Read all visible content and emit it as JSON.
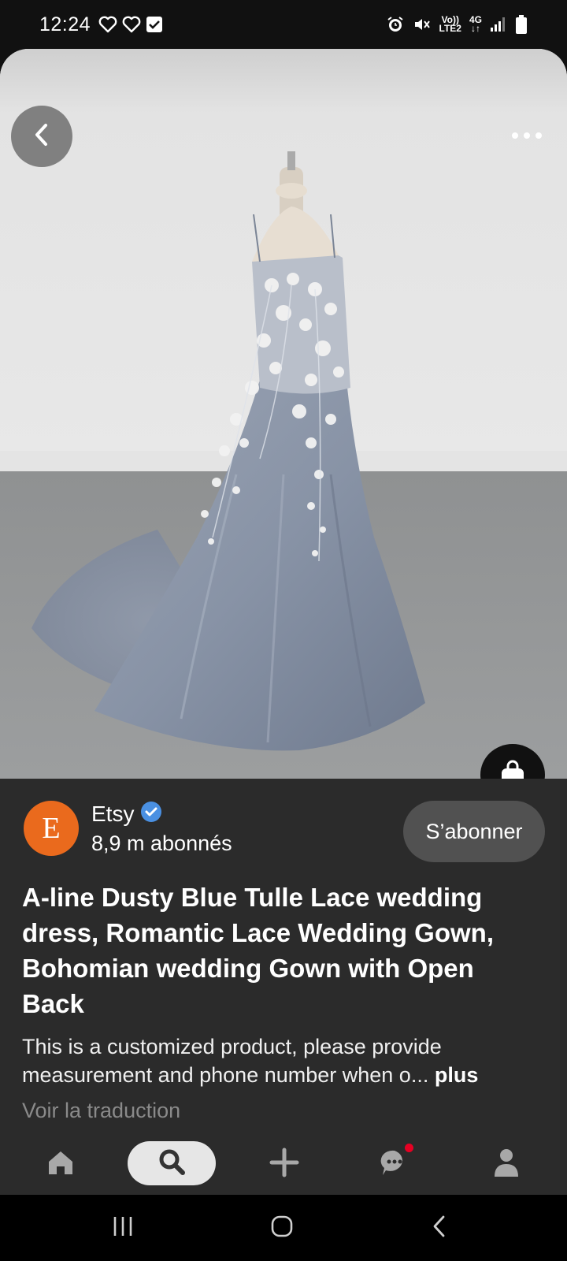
{
  "status_bar": {
    "time": "12:24",
    "left_icons": [
      "heart-outline-icon",
      "heart-outline-icon",
      "checkbox-icon"
    ],
    "right_icons": [
      "alarm-icon",
      "mute-icon",
      "volte-icon",
      "4g-icon",
      "signal-icon",
      "battery-icon"
    ],
    "volte_label": "Vo))",
    "lte_label": "LTE2",
    "network_label": "4G"
  },
  "hero": {
    "image_alt": "dusty blue tulle lace wedding dress on mannequin",
    "back_icon": "chevron-left-icon",
    "more_icon": "more-horizontal-icon",
    "shop_icon": "shopping-bag-icon"
  },
  "creator": {
    "logo_letter": "E",
    "name": "Etsy",
    "verified_icon": "verified-badge-icon",
    "followers": "8,9 m abonnés",
    "follow_label": "S’abonner"
  },
  "pin": {
    "title": "A-line Dusty Blue Tulle Lace wedding dress, Romantic Lace Wedding Gown, Bohomian wedding Gown with Open Back",
    "description_line1": "This is a customized product, please provide",
    "description_line2": "measurement and phone number when o...",
    "more_label": "plus",
    "translate_label": "Voir la traduction"
  },
  "bottom_nav": {
    "items": [
      "home-icon",
      "search-icon",
      "plus-icon",
      "messages-icon",
      "profile-icon"
    ],
    "active": "search-icon"
  },
  "colors": {
    "background": "#2b2b2b",
    "etsy_orange": "#ea6a1d",
    "verified_blue": "#4a90e2",
    "notification_red": "#e60023"
  }
}
